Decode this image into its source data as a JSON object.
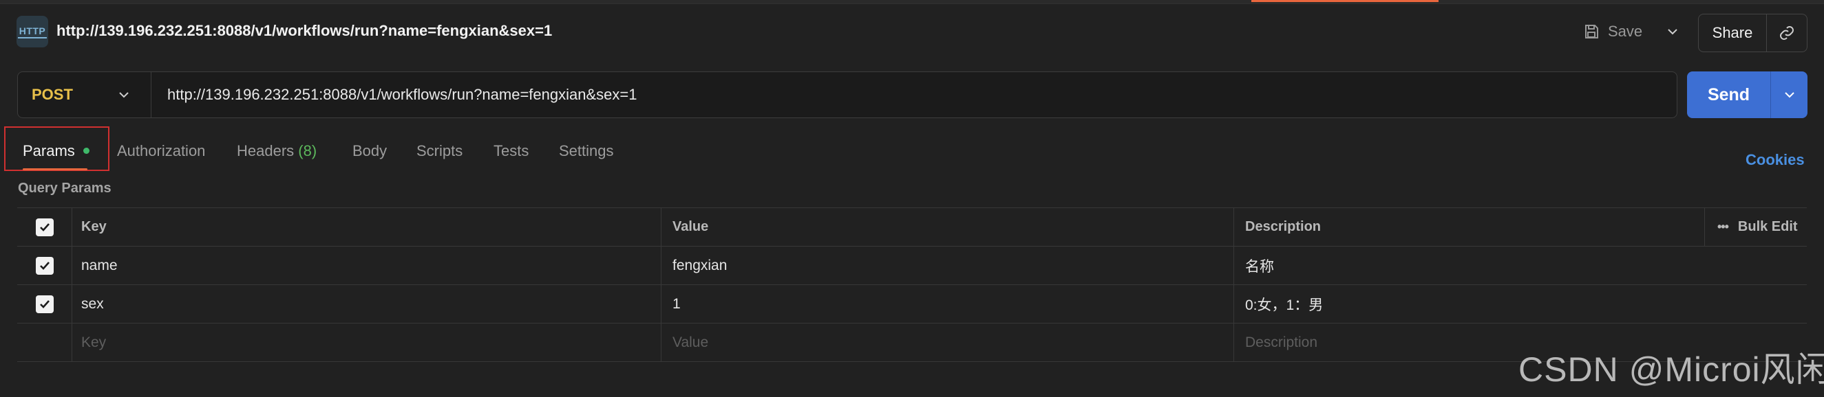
{
  "header": {
    "request_title": "http://139.196.232.251:8088/v1/workflows/run?name=fengxian&sex=1",
    "protocol_icon_text": "HTTP",
    "save_label": "Save",
    "share_label": "Share"
  },
  "request": {
    "method": "POST",
    "url": "http://139.196.232.251:8088/v1/workflows/run?name=fengxian&sex=1",
    "send_label": "Send"
  },
  "tabs": {
    "params": "Params",
    "authorization": "Authorization",
    "headers": "Headers",
    "headers_count": "(8)",
    "body": "Body",
    "scripts": "Scripts",
    "tests": "Tests",
    "settings": "Settings",
    "cookies": "Cookies"
  },
  "query_params": {
    "title": "Query Params",
    "columns": {
      "key": "Key",
      "value": "Value",
      "description": "Description",
      "bulk_edit": "Bulk Edit"
    },
    "rows": [
      {
        "checked": true,
        "key": "name",
        "value": "fengxian",
        "description": "名称"
      },
      {
        "checked": true,
        "key": "sex",
        "value": "1",
        "description": "0:女，1：男"
      }
    ],
    "placeholder": {
      "key": "Key",
      "value": "Value",
      "description": "Description"
    }
  },
  "watermark": "CSDN @Microi风闲",
  "colors": {
    "background": "#212121",
    "method_post": "#e8c04a",
    "send_button": "#3d6fd3",
    "active_underline": "#e8663d",
    "highlight_box": "#d03030",
    "cookies_link": "#4a90e2",
    "headers_count": "#5cb85c",
    "params_dot": "#3fb96a"
  }
}
